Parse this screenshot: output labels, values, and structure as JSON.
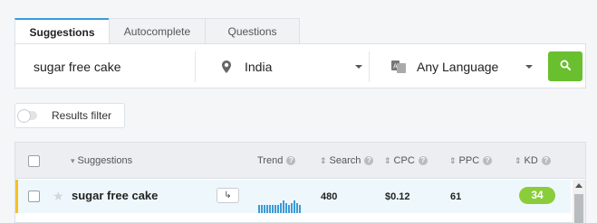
{
  "tabs": [
    {
      "label": "Suggestions",
      "active": true
    },
    {
      "label": "Autocomplete",
      "active": false
    },
    {
      "label": "Questions",
      "active": false
    }
  ],
  "search": {
    "keyword": "sugar free cake",
    "location": "India",
    "language": "Any Language",
    "location_icon": "map-pin-icon",
    "language_icon": "translate-icon",
    "go_icon": "search-icon",
    "go_color": "#6abf2e"
  },
  "filter": {
    "label": "Results filter",
    "enabled": false
  },
  "table": {
    "headers": {
      "suggestions": "Suggestions",
      "trend": "Trend",
      "search": "Search",
      "cpc": "CPC",
      "ppc": "PPC",
      "kd": "KD"
    },
    "rows": [
      {
        "keyword": "sugar free cake",
        "goto_icon": "arrow-return-icon",
        "trend": [
          0.55,
          0.55,
          0.55,
          0.55,
          0.55,
          0.55,
          0.55,
          0.55,
          0.7,
          0.9,
          0.7,
          0.55,
          0.7,
          0.85,
          0.7,
          0.55
        ],
        "search": "480",
        "cpc": "$0.12",
        "ppc": "61",
        "kd": "34",
        "kd_color": "#8acd3a",
        "highlight_color": "#f5c224"
      }
    ]
  }
}
